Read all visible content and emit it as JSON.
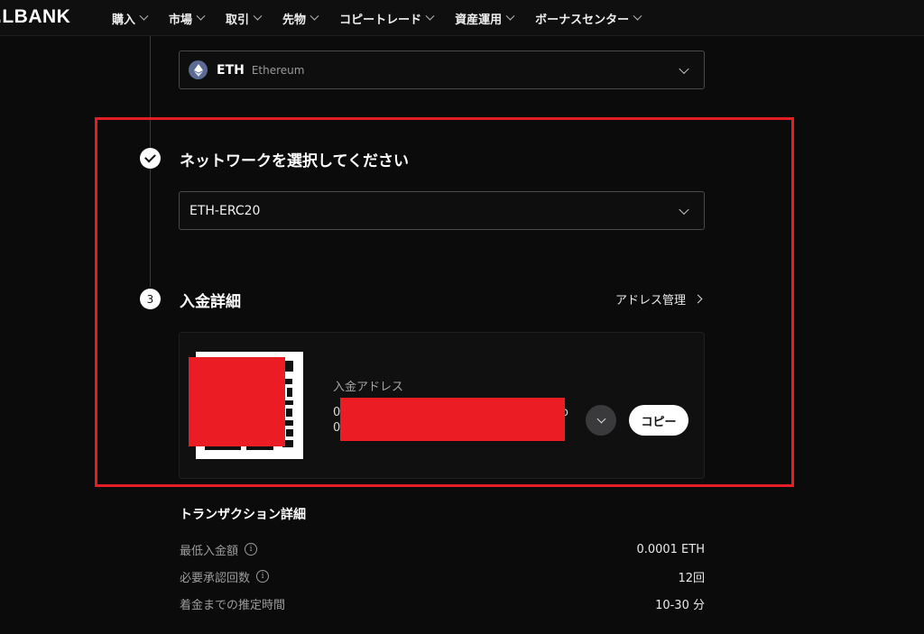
{
  "brand": {
    "logo_text": ".LBANK"
  },
  "nav": {
    "items": [
      {
        "label": "購入"
      },
      {
        "label": "市場"
      },
      {
        "label": "取引"
      },
      {
        "label": "先物"
      },
      {
        "label": "コピートレード"
      },
      {
        "label": "資産運用"
      },
      {
        "label": "ボーナスセンター"
      }
    ]
  },
  "coin_select": {
    "code": "ETH",
    "name": "Ethereum",
    "icon": "ethereum-icon"
  },
  "network": {
    "title": "ネットワークを選択してください",
    "selected": "ETH-ERC20"
  },
  "deposit": {
    "step_number": "3",
    "title": "入金詳細",
    "address_management": "アドレス管理",
    "address_label": "入金アドレス",
    "address_line1_start": "0",
    "address_line1_end": "o",
    "address_line2_start": "0",
    "copy_label": "コピー"
  },
  "transaction": {
    "title": "トランザクション詳細",
    "rows": [
      {
        "label": "最低入金額",
        "value": "0.0001 ETH",
        "info": true
      },
      {
        "label": "必要承認回数",
        "value": "12回",
        "info": true
      },
      {
        "label": "着金までの推定時間",
        "value": "10-30 分",
        "info": false
      }
    ]
  },
  "colors": {
    "background": "#0b0b0b",
    "highlight_border": "#e31e26",
    "redaction": "#ec1c24",
    "button_bg": "#ffffff"
  }
}
